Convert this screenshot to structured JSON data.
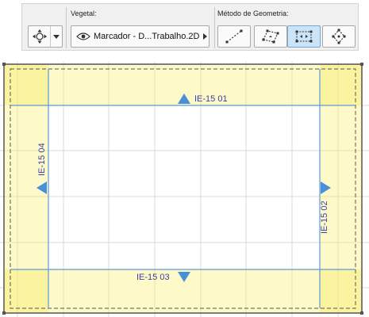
{
  "toolbar": {
    "placement_group": {
      "icon": "marker-placement-icon",
      "dropdown_icon": "chevron-down-icon"
    },
    "vegetal": {
      "label": "Vegetal:",
      "icon": "eye-icon",
      "value": "Marcador - D...Trabalho.2D",
      "dropdown_icon": "triangle-right-icon"
    },
    "geometry": {
      "label": "Método de Geometria:",
      "methods": [
        {
          "icon": "diagonal-line-icon",
          "selected": false
        },
        {
          "icon": "rotated-rectangle-icon",
          "selected": false
        },
        {
          "icon": "rectangle-icon",
          "selected": true
        },
        {
          "icon": "crosshair-points-icon",
          "selected": false
        }
      ]
    }
  },
  "canvas": {
    "markers": [
      {
        "id": "top",
        "label": "IE-15 01",
        "direction": "up"
      },
      {
        "id": "right",
        "label": "IE-15 02",
        "direction": "right"
      },
      {
        "id": "bottom",
        "label": "IE-15 03",
        "direction": "down"
      },
      {
        "id": "left",
        "label": "IE-15 04",
        "direction": "left"
      }
    ],
    "colors": {
      "elevation_fill": "#fdf9c4",
      "corner_fill": "#fbf3a0",
      "marker_line": "#5b9bd5",
      "marker_arrow": "#4a90d9",
      "marker_text": "#3a3fa6",
      "grid": "#d9d9d9",
      "frame": "#555555"
    }
  }
}
